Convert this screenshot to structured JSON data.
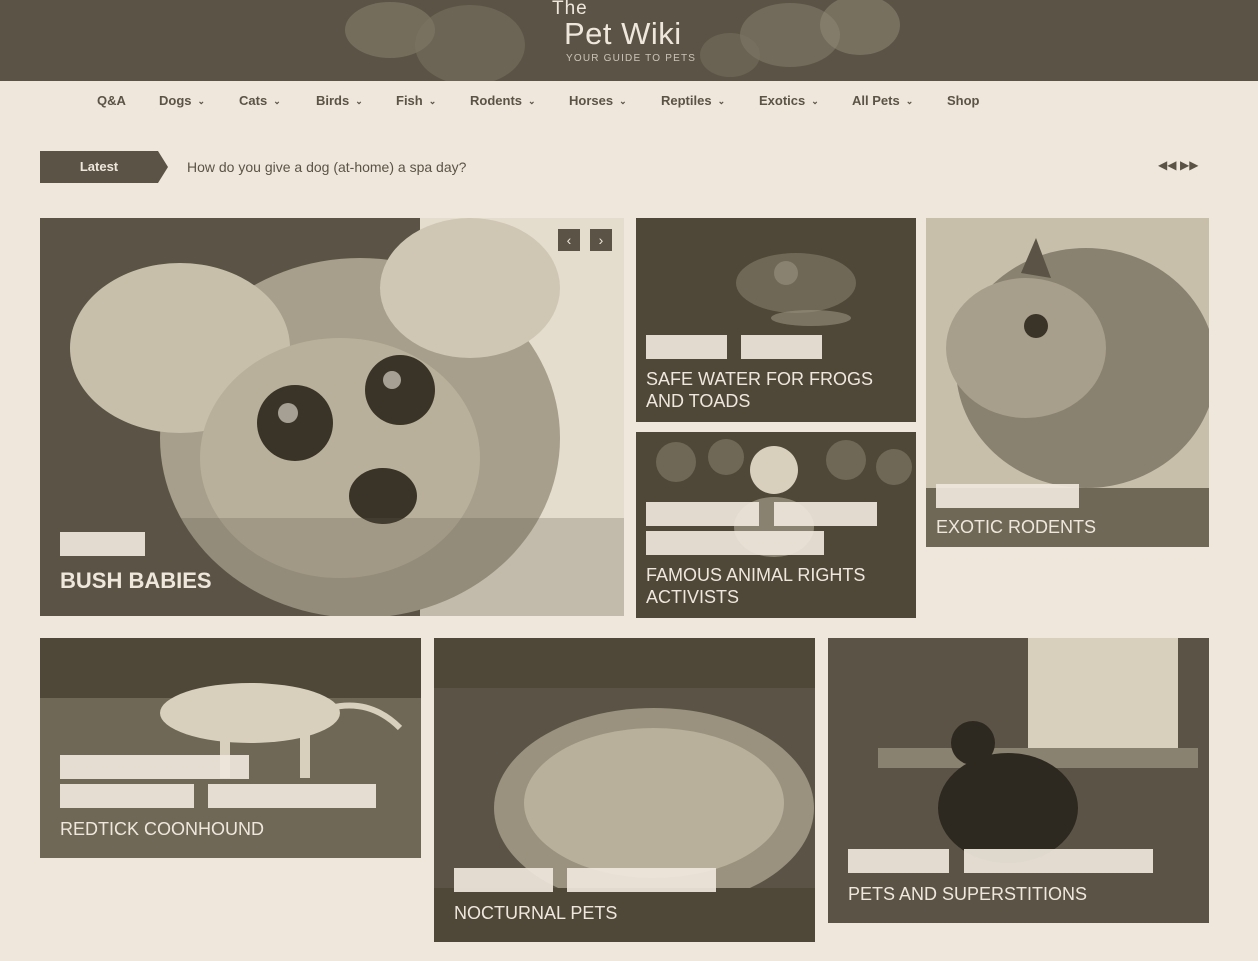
{
  "site": {
    "logo_the": "The",
    "logo_main": "Pet Wiki",
    "logo_tagline": "YOUR GUIDE TO PETS"
  },
  "nav": {
    "qa": "Q&A",
    "dogs": "Dogs",
    "cats": "Cats",
    "birds": "Birds",
    "fish": "Fish",
    "rodents": "Rodents",
    "horses": "Horses",
    "reptiles": "Reptiles",
    "exotics": "Exotics",
    "all_pets": "All Pets",
    "shop": "Shop"
  },
  "ticker": {
    "label": "Latest",
    "headline": "How do you give a dog (at-home) a spa day?"
  },
  "tiles": {
    "bush_babies": "BUSH BABIES",
    "frogs": "SAFE WATER FOR FROGS AND TOADS",
    "activists": "FAMOUS ANIMAL RIGHTS ACTIVISTS",
    "exotic_rodents": "EXOTIC RODENTS",
    "coonhound": "REDTICK COONHOUND",
    "nocturnal": "NOCTURNAL PETS",
    "superstitions": "PETS AND SUPERSTITIONS"
  },
  "colors": {
    "brand": "#5b5446",
    "background": "#efe7dc"
  }
}
